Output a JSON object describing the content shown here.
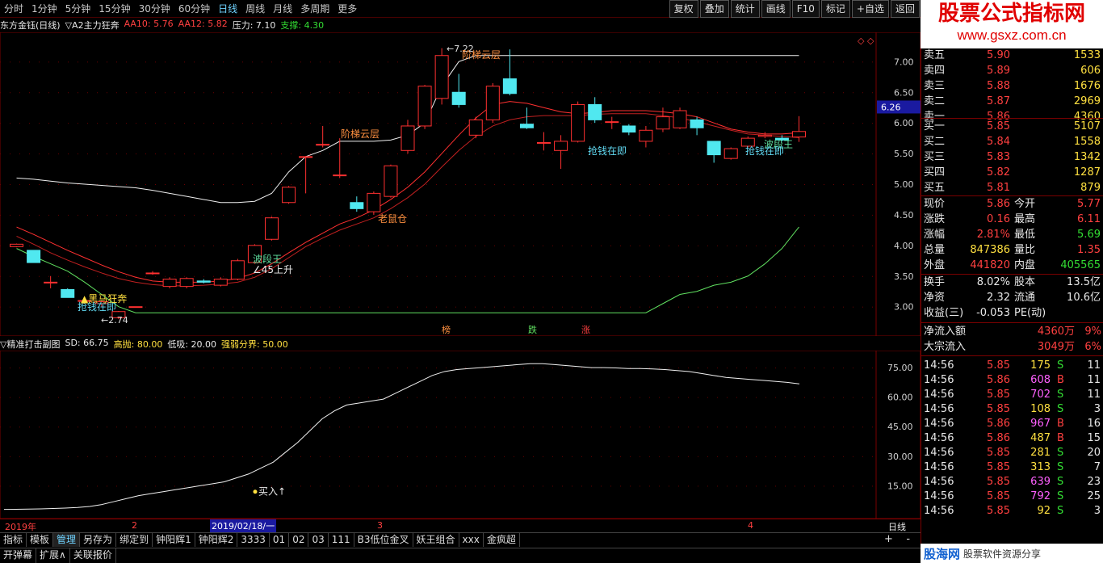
{
  "toolbar": {
    "periods": [
      "分时",
      "1分钟",
      "5分钟",
      "15分钟",
      "30分钟",
      "60分钟",
      "日线",
      "周线",
      "月线",
      "多周期",
      "更多"
    ],
    "active_period": "日线",
    "right_buttons": [
      "复权",
      "叠加",
      "统计",
      "画线",
      "F10",
      "标记",
      "+自选",
      "返回"
    ]
  },
  "watermark": {
    "title": "股票公式指标网",
    "url": "www.gsxz.com.cn",
    "bottom_name": "股海网",
    "bottom_url": "www.Guhai.com.cn",
    "bottom_slogan": "股票软件资源分享"
  },
  "main_info": {
    "name": "东方金钰(日线)",
    "indicator": "▽A2主力狂奔",
    "aa10": "AA10: 5.76",
    "aa12": "AA12: 5.82",
    "pressure": "压力: 7.10",
    "support": "支撑: 4.30"
  },
  "main_axis": [
    "7.00",
    "6.50",
    "6.00",
    "5.50",
    "5.00",
    "4.50",
    "4.00",
    "3.50",
    "3.00"
  ],
  "price_tag": "6.26",
  "annotations": {
    "high": "7.22",
    "low": "2.74",
    "tier_cloud1": "阶梯云层",
    "tier_cloud2": "阶梯云层",
    "mouse": "老鼠仓",
    "wave_king1": "波段王",
    "wave_king2": "波段王",
    "up45": "∠45上升",
    "grab_money1": "抢钱在即",
    "grab_money2": "抢钱在即",
    "grab_money3": "抢钱在即",
    "horse": "黑马狂奔",
    "bang": "榜",
    "die": "跌",
    "zhang": "涨"
  },
  "sub_info": {
    "name": "▽精准打击副图",
    "sd": "SD: 66.75",
    "high": "高抛: 80.00",
    "low": "低吸: 20.00",
    "line": "强弱分界: 50.00"
  },
  "sub_axis": [
    "75.00",
    "60.00",
    "45.00",
    "30.00",
    "15.00"
  ],
  "buy_label": "买入↑",
  "date_axis": {
    "year": "2019年",
    "m2": "2",
    "cursor": "2019/02/18/一",
    "m3": "3",
    "m4": "4",
    "period": "日线"
  },
  "order_book": {
    "sells": [
      {
        "label": "卖五",
        "price": "5.90",
        "vol": "1533"
      },
      {
        "label": "卖四",
        "price": "5.89",
        "vol": "606"
      },
      {
        "label": "卖三",
        "price": "5.88",
        "vol": "1676"
      },
      {
        "label": "卖二",
        "price": "5.87",
        "vol": "2969"
      },
      {
        "label": "卖一",
        "price": "5.86",
        "vol": "4360"
      }
    ],
    "buys": [
      {
        "label": "买一",
        "price": "5.85",
        "vol": "5107"
      },
      {
        "label": "买二",
        "price": "5.84",
        "vol": "1558"
      },
      {
        "label": "买三",
        "price": "5.83",
        "vol": "1342"
      },
      {
        "label": "买四",
        "price": "5.82",
        "vol": "1287"
      },
      {
        "label": "买五",
        "price": "5.81",
        "vol": "879"
      }
    ]
  },
  "quote": [
    {
      "l1": "现价",
      "v1": "5.86",
      "l2": "今开",
      "v2": "5.77",
      "c1": "red",
      "c2": "red"
    },
    {
      "l1": "涨跌",
      "v1": "0.16",
      "l2": "最高",
      "v2": "6.11",
      "c1": "red",
      "c2": "red"
    },
    {
      "l1": "涨幅",
      "v1": "2.81%",
      "l2": "最低",
      "v2": "5.69",
      "c1": "red",
      "c2": "green"
    },
    {
      "l1": "总量",
      "v1": "847386",
      "l2": "量比",
      "v2": "1.35",
      "c1": "yellow",
      "c2": "red"
    },
    {
      "l1": "外盘",
      "v1": "441820",
      "l2": "内盘",
      "v2": "405565",
      "c1": "red",
      "c2": "green"
    }
  ],
  "quote2": [
    {
      "l1": "换手",
      "v1": "8.02%",
      "l2": "股本",
      "v2": "13.5亿"
    },
    {
      "l1": "净资",
      "v1": "2.32",
      "l2": "流通",
      "v2": "10.6亿"
    },
    {
      "l1": "收益(三)",
      "v1": "-0.053",
      "l2": "PE(动)",
      "v2": ""
    }
  ],
  "flows": [
    {
      "l": "净流入额",
      "v": "4360万",
      "p": "9%"
    },
    {
      "l": "大宗流入",
      "v": "3049万",
      "p": "6%"
    }
  ],
  "ticks": [
    {
      "t": "14:56",
      "p": "5.85",
      "v": "175",
      "d": "S",
      "n": "11",
      "pc": "red",
      "vc": "yellow",
      "dc": "green"
    },
    {
      "t": "14:56",
      "p": "5.86",
      "v": "608",
      "d": "B",
      "n": "11",
      "pc": "red",
      "vc": "purple",
      "dc": "red"
    },
    {
      "t": "14:56",
      "p": "5.85",
      "v": "702",
      "d": "S",
      "n": "11",
      "pc": "red",
      "vc": "purple",
      "dc": "green"
    },
    {
      "t": "14:56",
      "p": "5.85",
      "v": "108",
      "d": "S",
      "n": "3",
      "pc": "red",
      "vc": "yellow",
      "dc": "green"
    },
    {
      "t": "14:56",
      "p": "5.86",
      "v": "967",
      "d": "B",
      "n": "16",
      "pc": "red",
      "vc": "purple",
      "dc": "red"
    },
    {
      "t": "14:56",
      "p": "5.86",
      "v": "487",
      "d": "B",
      "n": "15",
      "pc": "red",
      "vc": "yellow",
      "dc": "red"
    },
    {
      "t": "14:56",
      "p": "5.85",
      "v": "281",
      "d": "S",
      "n": "20",
      "pc": "red",
      "vc": "yellow",
      "dc": "green"
    },
    {
      "t": "14:56",
      "p": "5.85",
      "v": "313",
      "d": "S",
      "n": "7",
      "pc": "red",
      "vc": "yellow",
      "dc": "green"
    },
    {
      "t": "14:56",
      "p": "5.85",
      "v": "639",
      "d": "S",
      "n": "23",
      "pc": "red",
      "vc": "purple",
      "dc": "green"
    },
    {
      "t": "14:56",
      "p": "5.85",
      "v": "792",
      "d": "S",
      "n": "25",
      "pc": "red",
      "vc": "purple",
      "dc": "green"
    },
    {
      "t": "14:56",
      "p": "5.85",
      "v": "92",
      "d": "S",
      "n": "3",
      "pc": "red",
      "vc": "yellow",
      "dc": "green"
    }
  ],
  "bottom_tabs": [
    "指标",
    "模板",
    "管理",
    "另存为",
    "绑定到",
    "钟阳辉1",
    "钟阳辉2",
    "3333",
    "01",
    "02",
    "03",
    "111",
    "B3低位金叉",
    "妖王组合",
    "xxx",
    "金疯超"
  ],
  "active_bottom_tab": "管理",
  "bottom_tabs2": [
    "开弹幕",
    "扩展∧",
    "关联报价"
  ],
  "candles": [
    {
      "o": 3.98,
      "c": 4.02,
      "h": 4.03,
      "l": 3.97
    },
    {
      "o": 3.92,
      "c": 3.72,
      "h": 3.92,
      "l": 3.72
    },
    {
      "o": 3.4,
      "c": 3.4,
      "h": 3.5,
      "l": 3.3
    },
    {
      "o": 3.28,
      "c": 3.15,
      "h": 3.3,
      "l": 3.15
    },
    {
      "o": 3.1,
      "c": 3.1,
      "h": 3.1,
      "l": 3.1
    },
    {
      "o": 3.05,
      "c": 3.08,
      "h": 3.1,
      "l": 3.0
    },
    {
      "o": 2.82,
      "c": 2.92,
      "h": 2.93,
      "l": 2.8
    },
    {
      "o": 3.0,
      "c": 3.0,
      "h": 3.0,
      "l": 3.0
    },
    {
      "o": 3.55,
      "c": 3.55,
      "h": 3.58,
      "l": 3.52
    },
    {
      "o": 3.33,
      "c": 3.45,
      "h": 3.48,
      "l": 3.3
    },
    {
      "o": 3.33,
      "c": 3.46,
      "h": 3.48,
      "l": 3.3
    },
    {
      "o": 3.42,
      "c": 3.4,
      "h": 3.45,
      "l": 3.38
    },
    {
      "o": 3.35,
      "c": 3.45,
      "h": 3.48,
      "l": 3.33
    },
    {
      "o": 3.45,
      "c": 3.75,
      "h": 3.78,
      "l": 3.43
    },
    {
      "o": 3.72,
      "c": 4.0,
      "h": 4.02,
      "l": 3.7
    },
    {
      "o": 4.1,
      "c": 4.45,
      "h": 4.47,
      "l": 4.08
    },
    {
      "o": 4.7,
      "c": 4.95,
      "h": 4.97,
      "l": 4.68
    },
    {
      "o": 5.45,
      "c": 5.45,
      "h": 5.46,
      "l": 4.85
    },
    {
      "o": 5.65,
      "c": 5.65,
      "h": 5.95,
      "l": 5.6
    },
    {
      "o": 5.15,
      "c": 5.15,
      "h": 5.75,
      "l": 5.1
    },
    {
      "o": 4.7,
      "c": 4.6,
      "h": 4.8,
      "l": 4.55
    },
    {
      "o": 4.55,
      "c": 4.85,
      "h": 4.88,
      "l": 4.5
    },
    {
      "o": 4.8,
      "c": 5.3,
      "h": 5.32,
      "l": 4.78
    },
    {
      "o": 5.55,
      "c": 5.95,
      "h": 6.05,
      "l": 5.5
    },
    {
      "o": 5.95,
      "c": 6.6,
      "h": 6.62,
      "l": 5.9
    },
    {
      "o": 6.4,
      "c": 7.1,
      "h": 7.22,
      "l": 6.3
    },
    {
      "o": 6.5,
      "c": 6.3,
      "h": 6.8,
      "l": 6.25
    },
    {
      "o": 5.8,
      "c": 6.05,
      "h": 6.1,
      "l": 5.75
    },
    {
      "o": 6.05,
      "c": 6.6,
      "h": 6.65,
      "l": 6.0
    },
    {
      "o": 6.72,
      "c": 6.48,
      "h": 7.2,
      "l": 6.45
    },
    {
      "o": 5.98,
      "c": 5.92,
      "h": 6.25,
      "l": 5.9
    },
    {
      "o": 5.68,
      "c": 5.68,
      "h": 5.85,
      "l": 5.55
    },
    {
      "o": 5.55,
      "c": 5.7,
      "h": 5.8,
      "l": 5.25
    },
    {
      "o": 5.7,
      "c": 6.3,
      "h": 6.35,
      "l": 5.68
    },
    {
      "o": 6.3,
      "c": 6.05,
      "h": 6.42,
      "l": 6.0
    },
    {
      "o": 6.02,
      "c": 6.02,
      "h": 6.1,
      "l": 5.9
    },
    {
      "o": 5.95,
      "c": 5.85,
      "h": 5.98,
      "l": 5.8
    },
    {
      "o": 5.7,
      "c": 5.88,
      "h": 5.95,
      "l": 5.6
    },
    {
      "o": 5.9,
      "c": 6.1,
      "h": 6.25,
      "l": 5.85
    },
    {
      "o": 5.92,
      "c": 6.2,
      "h": 6.25,
      "l": 5.9
    },
    {
      "o": 6.05,
      "c": 5.92,
      "h": 6.1,
      "l": 5.8
    },
    {
      "o": 5.7,
      "c": 5.48,
      "h": 5.7,
      "l": 5.35
    },
    {
      "o": 5.42,
      "c": 5.58,
      "h": 5.6,
      "l": 5.4
    },
    {
      "o": 5.62,
      "c": 5.75,
      "h": 5.78,
      "l": 5.6
    },
    {
      "o": 5.78,
      "c": 5.8,
      "h": 5.85,
      "l": 5.75
    },
    {
      "o": 5.75,
      "c": 5.72,
      "h": 5.8,
      "l": 5.7
    },
    {
      "o": 5.77,
      "c": 5.86,
      "h": 6.11,
      "l": 5.69
    }
  ],
  "sub_series": [
    3,
    3.1,
    3.2,
    3.3,
    3.5,
    3.7,
    4,
    4.5,
    5.5,
    7,
    8.5,
    10,
    11,
    12,
    13,
    14,
    15,
    16,
    17,
    19,
    21,
    24,
    27,
    32,
    37,
    43,
    49,
    53,
    56,
    57,
    58,
    59,
    62,
    65,
    68,
    71,
    73,
    74,
    74.5,
    75,
    75.5,
    76,
    76.5,
    77,
    77,
    76.5,
    76,
    75.5,
    75,
    75,
    74.8,
    74.5,
    74.5,
    74.3,
    74,
    73.5,
    73,
    72,
    71,
    70,
    69.5,
    69,
    68.5,
    68,
    67.5,
    66.75
  ],
  "lines": {
    "white": [
      5.1,
      5.08,
      5.05,
      5.02,
      5.0,
      4.98,
      4.96,
      4.94,
      4.9,
      4.85,
      4.8,
      4.75,
      4.7,
      4.7,
      4.72,
      4.85,
      5.2,
      5.45,
      5.55,
      5.7,
      5.7,
      5.7,
      5.72,
      5.8,
      6.0,
      6.6,
      7.0,
      7.1,
      7.1,
      7.1,
      7.1,
      7.1,
      7.1,
      7.1,
      7.1,
      7.1,
      7.1,
      7.1,
      7.1,
      7.1,
      7.1,
      7.1,
      7.1,
      7.1,
      7.1,
      7.1,
      7.1
    ],
    "red1": [
      4.3,
      4.18,
      4.05,
      3.92,
      3.8,
      3.68,
      3.57,
      3.48,
      3.42,
      3.4,
      3.4,
      3.4,
      3.42,
      3.46,
      3.55,
      3.7,
      3.88,
      4.05,
      4.2,
      4.35,
      4.45,
      4.58,
      4.75,
      4.95,
      5.2,
      5.5,
      5.8,
      6.08,
      6.3,
      6.35,
      6.32,
      6.25,
      6.18,
      6.15,
      6.17,
      6.2,
      6.2,
      6.2,
      6.18,
      6.15,
      6.1,
      6.0,
      5.9,
      5.85,
      5.82,
      5.82,
      5.84
    ],
    "red2": [
      4.15,
      4.02,
      3.88,
      3.76,
      3.65,
      3.55,
      3.46,
      3.4,
      3.36,
      3.34,
      3.34,
      3.35,
      3.37,
      3.4,
      3.48,
      3.62,
      3.8,
      3.98,
      4.12,
      4.25,
      4.35,
      4.45,
      4.6,
      4.78,
      5.0,
      5.28,
      5.55,
      5.78,
      5.95,
      6.05,
      6.1,
      6.12,
      6.12,
      6.12,
      6.14,
      6.15,
      6.15,
      6.15,
      6.12,
      6.08,
      6.02,
      5.95,
      5.88,
      5.82,
      5.8,
      5.78,
      5.76
    ],
    "green": [
      3.95,
      3.82,
      3.7,
      3.58,
      3.4,
      3.2,
      3.0,
      2.9,
      2.9,
      2.9,
      2.9,
      2.9,
      2.9,
      2.9,
      2.9,
      2.9,
      2.9,
      2.9,
      2.9,
      2.9,
      2.9,
      2.9,
      2.9,
      2.9,
      2.9,
      2.9,
      2.9,
      2.9,
      2.9,
      2.9,
      2.9,
      2.9,
      2.9,
      2.9,
      2.9,
      2.9,
      2.9,
      2.9,
      3.05,
      3.2,
      3.25,
      3.35,
      3.4,
      3.5,
      3.7,
      3.95,
      4.3
    ]
  }
}
